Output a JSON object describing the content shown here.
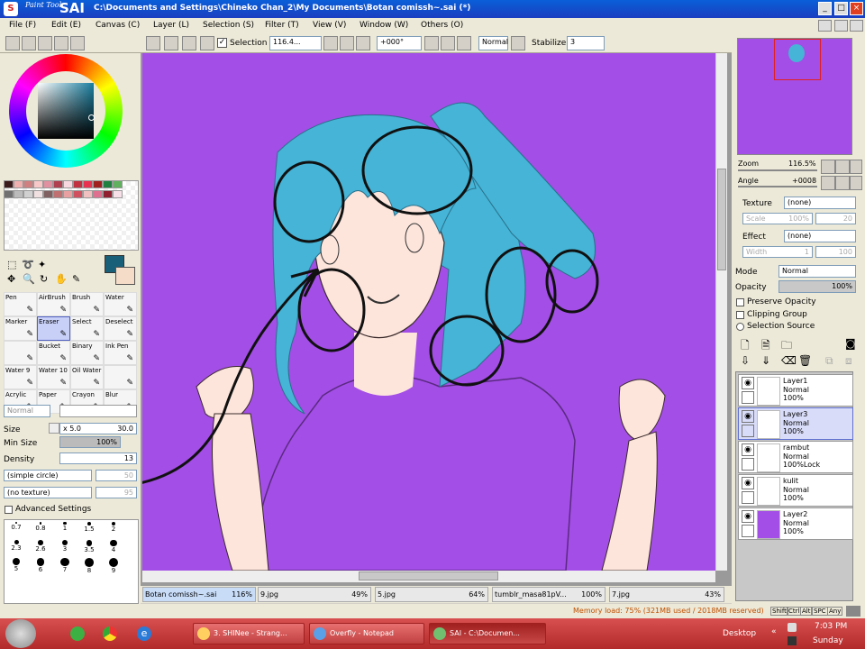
{
  "window": {
    "title": "C:\\Documents and Settings\\Chineko Chan_2\\My Documents\\Botan comissh~.sai (*)",
    "logo_small": "Paint Tool",
    "logo_big": "SAI"
  },
  "menu": [
    "File (F)",
    "Edit (E)",
    "Canvas (C)",
    "Layer (L)",
    "Selection (S)",
    "Filter (T)",
    "View (V)",
    "Window (W)",
    "Others (O)"
  ],
  "toolbar": {
    "selection_label": "Selection",
    "zoom_value": "116.4...",
    "angle_value": "+000°",
    "mode_value": "Normal",
    "stabilizer_label": "Stabilizer",
    "stabilizer_value": "3"
  },
  "tools": [
    [
      "Pen",
      "AirBrush",
      "Brush",
      "Water"
    ],
    [
      "Marker",
      "Eraser",
      "Select",
      "Deselect"
    ],
    [
      "",
      "Bucket",
      "Binary",
      "Ink Pen"
    ],
    [
      "Water 9",
      "Water 10",
      "Oil Water",
      ""
    ],
    [
      "Acrylic",
      "Paper",
      "Crayon",
      "Blur"
    ]
  ],
  "brush": {
    "mode": "Normal",
    "size_label": "Size",
    "size_mult": "x 5.0",
    "size_value": "30.0",
    "min_size_label": "Min Size",
    "min_size_value": "100%",
    "density_label": "Density",
    "density_value": "13",
    "shape": "(simple circle)",
    "shape_value": "50",
    "texture": "(no texture)",
    "texture_value": "95",
    "advanced": "Advanced Settings"
  },
  "brush_sizes": [
    "0.7",
    "0.8",
    "1",
    "1.5",
    "2",
    "2.3",
    "2.6",
    "3",
    "3.5",
    "4",
    "5",
    "6",
    "7",
    "8",
    "9"
  ],
  "navigator": {
    "zoom_label": "Zoom",
    "zoom_value": "116.5%",
    "angle_label": "Angle",
    "angle_value": "+0008"
  },
  "layer_props": {
    "texture_label": "Texture",
    "texture_value": "(none)",
    "scale_label": "Scale",
    "scale_value": "100%",
    "scale_num": "20",
    "effect_label": "Effect",
    "effect_value": "(none)",
    "width_label": "Width",
    "width_value": "1",
    "width_num": "100",
    "mode_label": "Mode",
    "mode_value": "Normal",
    "opacity_label": "Opacity",
    "opacity_value": "100%",
    "preserve_opacity": "Preserve Opacity",
    "clipping_group": "Clipping Group",
    "selection_source": "Selection Source"
  },
  "layers": [
    {
      "name": "Layer1",
      "mode": "Normal",
      "opacity": "100%",
      "selected": false,
      "thumb": "#ffffff"
    },
    {
      "name": "Layer3",
      "mode": "Normal",
      "opacity": "100%",
      "selected": true,
      "thumb": "#ffffff"
    },
    {
      "name": "rambut",
      "mode": "Normal",
      "opacity": "100%Lock",
      "selected": false,
      "thumb": "#ffffff"
    },
    {
      "name": "kulit",
      "mode": "Normal",
      "opacity": "100%",
      "selected": false,
      "thumb": "#ffffff"
    },
    {
      "name": "Layer2",
      "mode": "Normal",
      "opacity": "100%",
      "selected": false,
      "thumb": "#a34ee6"
    }
  ],
  "doc_tabs": [
    {
      "name": "Botan comissh~.sai",
      "zoom": "116%"
    },
    {
      "name": "9.jpg",
      "zoom": "49%"
    },
    {
      "name": "5.jpg",
      "zoom": "64%"
    },
    {
      "name": "tumblr_masa81pV...",
      "zoom": "100%"
    },
    {
      "name": "7.jpg",
      "zoom": "43%"
    }
  ],
  "status": {
    "memory": "Memory load: 75% (321MB used / 2018MB reserved)",
    "keys": [
      "Shift",
      "Ctrl",
      "Alt",
      "SPC",
      "Any"
    ]
  },
  "taskbar": {
    "items": [
      "3. SHINee - Strang...",
      "Overfly - Notepad",
      "SAI - C:\\Documen..."
    ],
    "desktop": "Desktop",
    "time": "7:03 PM",
    "day": "Sunday"
  },
  "colors": {
    "canvas_bg": "#a34ee6",
    "hair": "#45b4d6",
    "skin": "#fde5dc",
    "current_color": "#1a5f78",
    "title_bar": "#0a5fd8",
    "taskbar": "#c03a3a"
  }
}
